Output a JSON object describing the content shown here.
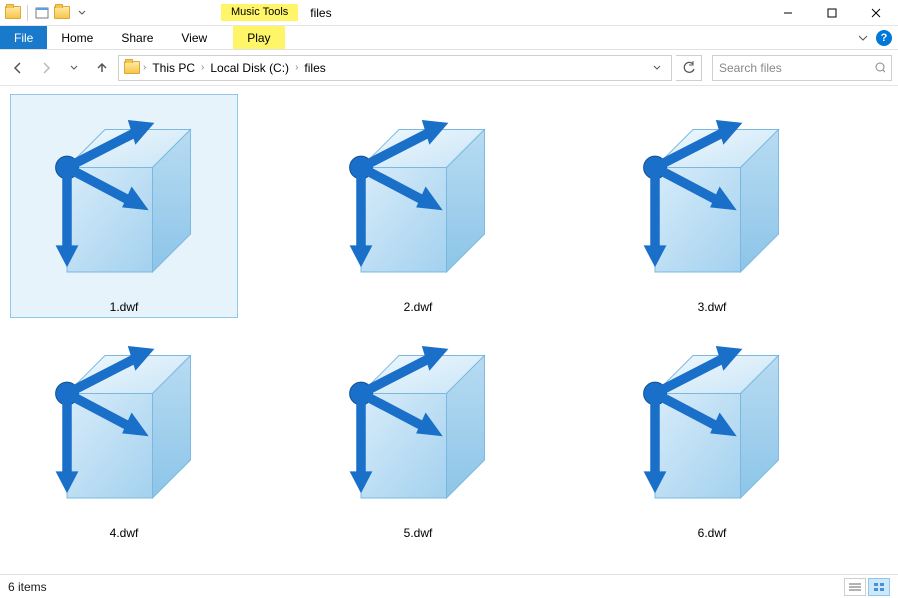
{
  "window": {
    "title": "files"
  },
  "context_tab": {
    "label": "Music Tools",
    "sub": "Play"
  },
  "ribbon": {
    "file": "File",
    "tabs": [
      "Home",
      "Share",
      "View"
    ]
  },
  "breadcrumbs": {
    "items": [
      "This PC",
      "Local Disk (C:)",
      "files"
    ]
  },
  "search": {
    "placeholder": "Search files"
  },
  "files": [
    {
      "name": "1.dwf",
      "selected": true
    },
    {
      "name": "2.dwf",
      "selected": false
    },
    {
      "name": "3.dwf",
      "selected": false
    },
    {
      "name": "4.dwf",
      "selected": false
    },
    {
      "name": "5.dwf",
      "selected": false
    },
    {
      "name": "6.dwf",
      "selected": false
    }
  ],
  "status": {
    "count_label": "6 items"
  }
}
